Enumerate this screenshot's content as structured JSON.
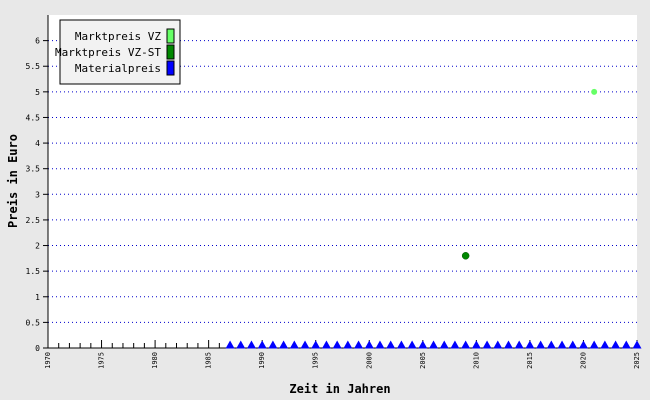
{
  "chart_data": {
    "type": "scatter",
    "xlabel": "Zeit in Jahren",
    "ylabel": "Preis in Euro",
    "xlim": [
      1970,
      2025
    ],
    "ylim": [
      0,
      6.5
    ],
    "xticks": [
      "1970",
      "1975",
      "1980",
      "1985",
      "1990",
      "1995",
      "2000",
      "2005",
      "2010",
      "2015",
      "2020",
      "2025"
    ],
    "yticks": [
      "0",
      "0.5",
      "1",
      "1.5",
      "2",
      "2.5",
      "3",
      "3.5",
      "4",
      "4.5",
      "5",
      "5.5",
      "6"
    ],
    "grid": "horizontal dotted",
    "legend_position": "top-left",
    "series": [
      {
        "name": "Marktpreis VZ",
        "color": "#66ff66",
        "marker": "circle",
        "points": [
          [
            2021,
            5.0
          ]
        ]
      },
      {
        "name": "Marktpreis VZ-ST",
        "color": "#008800",
        "marker": "circle",
        "points": [
          [
            2009,
            1.8
          ]
        ]
      },
      {
        "name": "Materialpreis",
        "color": "#0000ff",
        "marker": "triangle",
        "points": [
          [
            1987,
            0
          ],
          [
            1988,
            0
          ],
          [
            1989,
            0
          ],
          [
            1990,
            0
          ],
          [
            1991,
            0
          ],
          [
            1992,
            0
          ],
          [
            1993,
            0
          ],
          [
            1994,
            0
          ],
          [
            1995,
            0
          ],
          [
            1996,
            0
          ],
          [
            1997,
            0
          ],
          [
            1998,
            0
          ],
          [
            1999,
            0
          ],
          [
            2000,
            0
          ],
          [
            2001,
            0
          ],
          [
            2002,
            0
          ],
          [
            2003,
            0
          ],
          [
            2004,
            0
          ],
          [
            2005,
            0
          ],
          [
            2006,
            0
          ],
          [
            2007,
            0
          ],
          [
            2008,
            0
          ],
          [
            2009,
            0
          ],
          [
            2010,
            0
          ],
          [
            2011,
            0
          ],
          [
            2012,
            0
          ],
          [
            2013,
            0
          ],
          [
            2014,
            0
          ],
          [
            2015,
            0
          ],
          [
            2016,
            0
          ],
          [
            2017,
            0
          ],
          [
            2018,
            0
          ],
          [
            2019,
            0
          ],
          [
            2020,
            0
          ],
          [
            2021,
            0
          ],
          [
            2022,
            0
          ],
          [
            2023,
            0
          ],
          [
            2024,
            0
          ],
          [
            2025,
            0
          ]
        ]
      }
    ]
  }
}
